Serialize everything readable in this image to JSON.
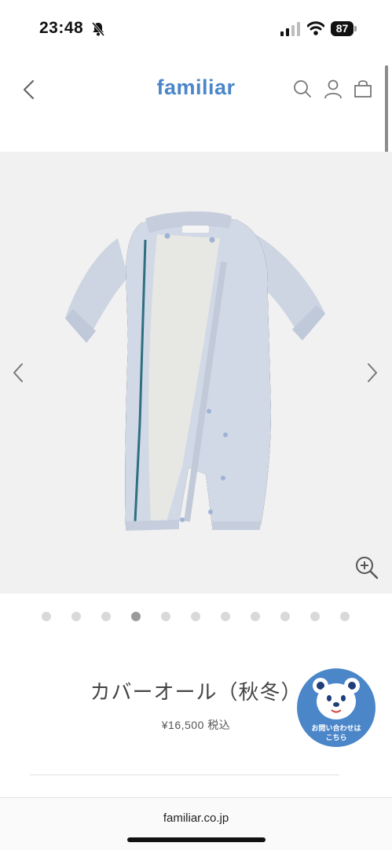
{
  "status_bar": {
    "time": "23:48",
    "battery": "87"
  },
  "header": {
    "brand": "familiar"
  },
  "gallery": {
    "total_slides": 11,
    "active_index": 3
  },
  "product": {
    "title": "カバーオール（秋冬）",
    "price": "¥16,500",
    "tax_label": "税込"
  },
  "contact": {
    "line1": "お問い合わせは",
    "line2": "こちら"
  },
  "browser": {
    "url": "familiar.co.jp"
  },
  "colors": {
    "brand": "#4a86c8",
    "contact_bg": "#4b86c9",
    "gallery_bg": "#f1f1f1"
  }
}
